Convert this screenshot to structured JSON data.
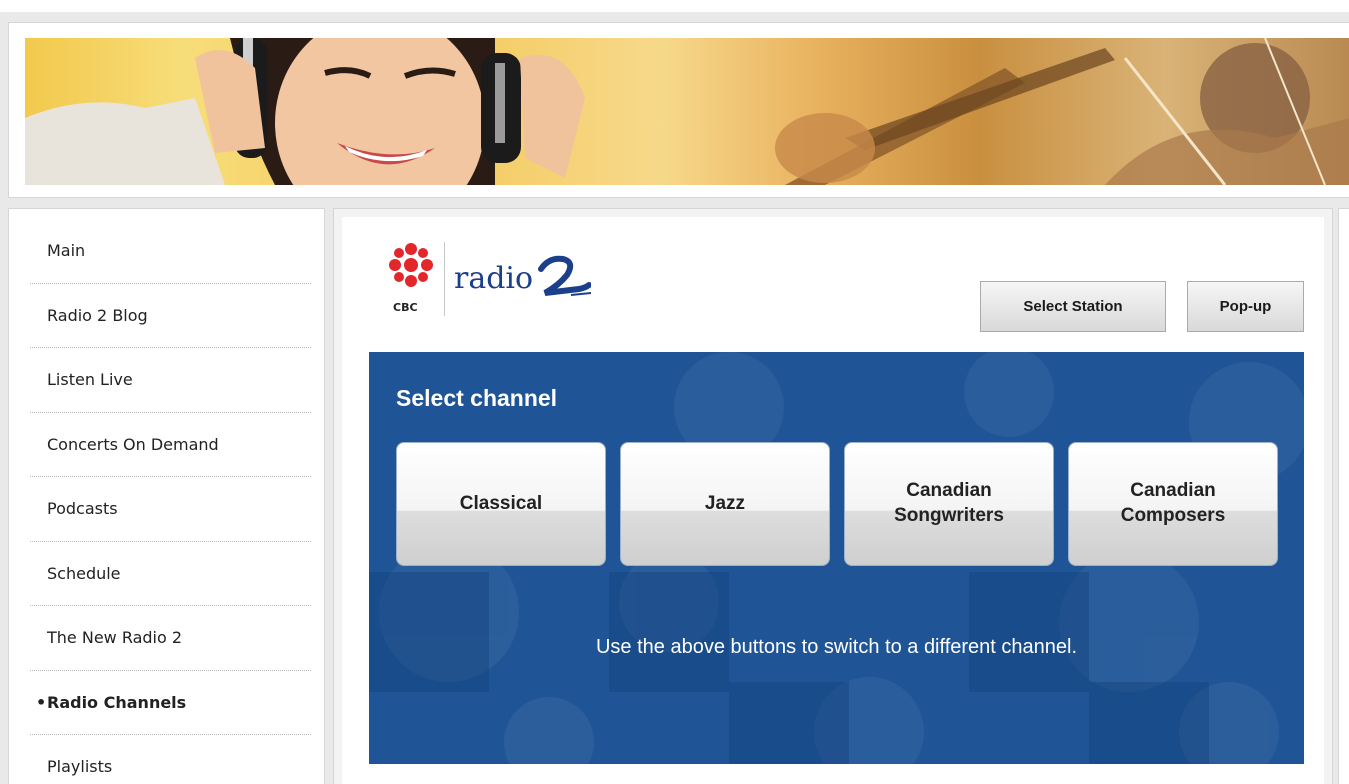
{
  "colors": {
    "panel_blue": "#1f5596",
    "cbc_red": "#e3262c",
    "radio2_blue": "#1c3f8c"
  },
  "banner": {
    "image": "banner-photo"
  },
  "sidebar": {
    "items": [
      {
        "label": "Main",
        "active": false
      },
      {
        "label": "Radio 2 Blog",
        "active": false
      },
      {
        "label": "Listen Live",
        "active": false
      },
      {
        "label": "Concerts On Demand",
        "active": false
      },
      {
        "label": "Podcasts",
        "active": false
      },
      {
        "label": "Schedule",
        "active": false
      },
      {
        "label": "The New Radio 2",
        "active": false
      },
      {
        "label": "Radio Channels",
        "active": true,
        "bullet": "•"
      },
      {
        "label": "Playlists",
        "active": false
      }
    ]
  },
  "logo": {
    "network": "CBC",
    "brand": "radio",
    "brand_number": "2",
    "icon": "cbc-gem-icon"
  },
  "toolbar": {
    "select_station_label": "Select Station",
    "popup_label": "Pop-up"
  },
  "channels": {
    "title": "Select channel",
    "buttons": [
      {
        "label": "Classical"
      },
      {
        "label": "Jazz"
      },
      {
        "label": "Canadian\nSongwriters"
      },
      {
        "label": "Canadian\nComposers"
      }
    ],
    "hint": "Use the above buttons to switch to a different channel."
  }
}
